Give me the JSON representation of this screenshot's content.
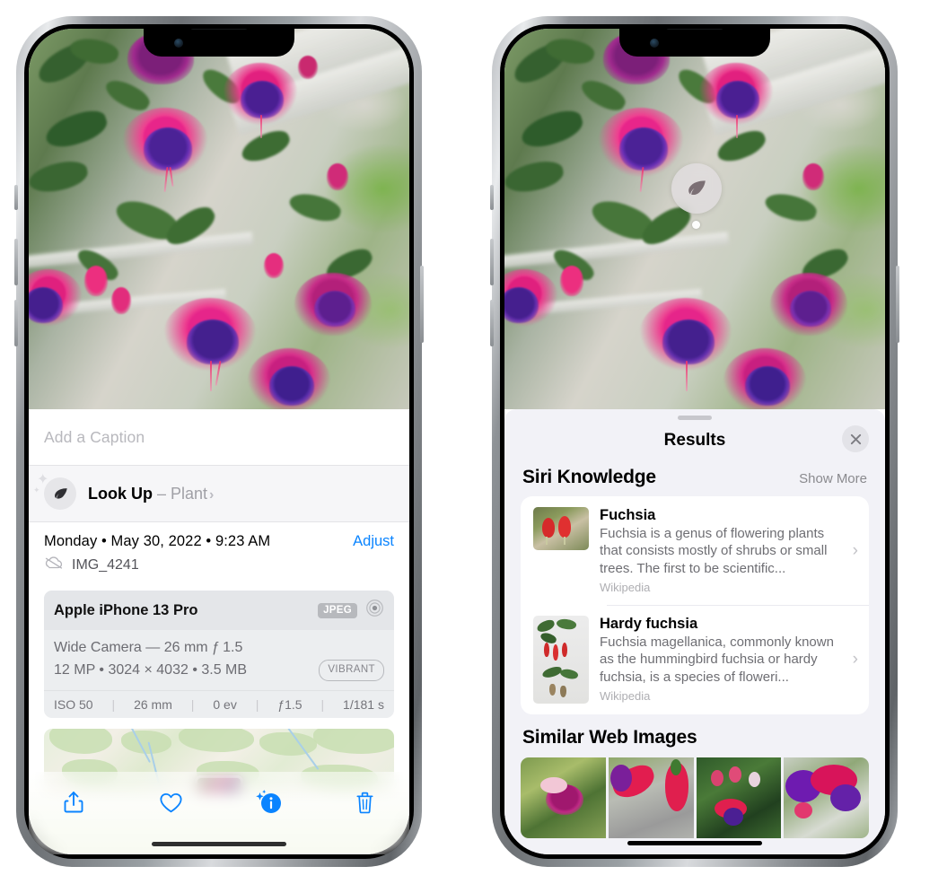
{
  "left_phone": {
    "photo": {
      "alt": "fuchsia-flowers-photo"
    },
    "caption": {
      "placeholder": "Add a Caption",
      "value": ""
    },
    "look_up": {
      "icon": "leaf-icon",
      "label": "Look Up",
      "dash": " – ",
      "subject": "Plant",
      "chevron": "›"
    },
    "date_row": {
      "date": "Monday • May 30, 2022 • 9:23 AM",
      "adjust_label": "Adjust",
      "cloud_icon": "cloud-slash-icon",
      "filename": "IMG_4241"
    },
    "exif": {
      "device": "Apple iPhone 13 Pro",
      "format_badge": "JPEG",
      "aperture_icon": "aperture-icon",
      "lens_line": "Wide Camera — 26 mm ƒ 1.5",
      "size_line": "12 MP  •  3024 × 4032  •  3.5 MB",
      "style_badge": "VIBRANT",
      "stats": [
        {
          "label": "ISO 50"
        },
        {
          "label": "26 mm"
        },
        {
          "label": "0 ev"
        },
        {
          "label": "ƒ1.5"
        },
        {
          "label": "1/181 s"
        }
      ],
      "separator": "|"
    },
    "map": {
      "name": "location-map-thumbnail",
      "pin": "photo-pin"
    },
    "toolbar": [
      {
        "name": "share-button",
        "icon": "share-icon"
      },
      {
        "name": "favorite-button",
        "icon": "heart-icon"
      },
      {
        "name": "info-button",
        "icon": "info-sparkle-icon"
      },
      {
        "name": "delete-button",
        "icon": "trash-icon"
      }
    ],
    "accent_color": "#0a84ff"
  },
  "right_phone": {
    "photo_badge": {
      "icon": "leaf-icon",
      "name": "visual-look-up-badge"
    },
    "sheet": {
      "grabber": "sheet-grabber",
      "title": "Results",
      "close_icon": "close-icon"
    },
    "siri_knowledge": {
      "title": "Siri Knowledge",
      "show_more": "Show More",
      "items": [
        {
          "title": "Fuchsia",
          "description": "Fuchsia is a genus of flowering plants that consists mostly of shrubs or small trees. The first to be scientific...",
          "source": "Wikipedia",
          "chevron": "›"
        },
        {
          "title": "Hardy fuchsia",
          "description": "Fuchsia magellanica, commonly known as the hummingbird fuchsia or hardy fuchsia, is a species of floweri...",
          "source": "Wikipedia",
          "chevron": "›"
        }
      ]
    },
    "similar_web_images": {
      "title": "Similar Web Images",
      "thumbnails": [
        {
          "name": "web-image-1"
        },
        {
          "name": "web-image-2"
        },
        {
          "name": "web-image-3"
        },
        {
          "name": "web-image-4"
        }
      ]
    },
    "panel_color": "#f2f2f7"
  }
}
